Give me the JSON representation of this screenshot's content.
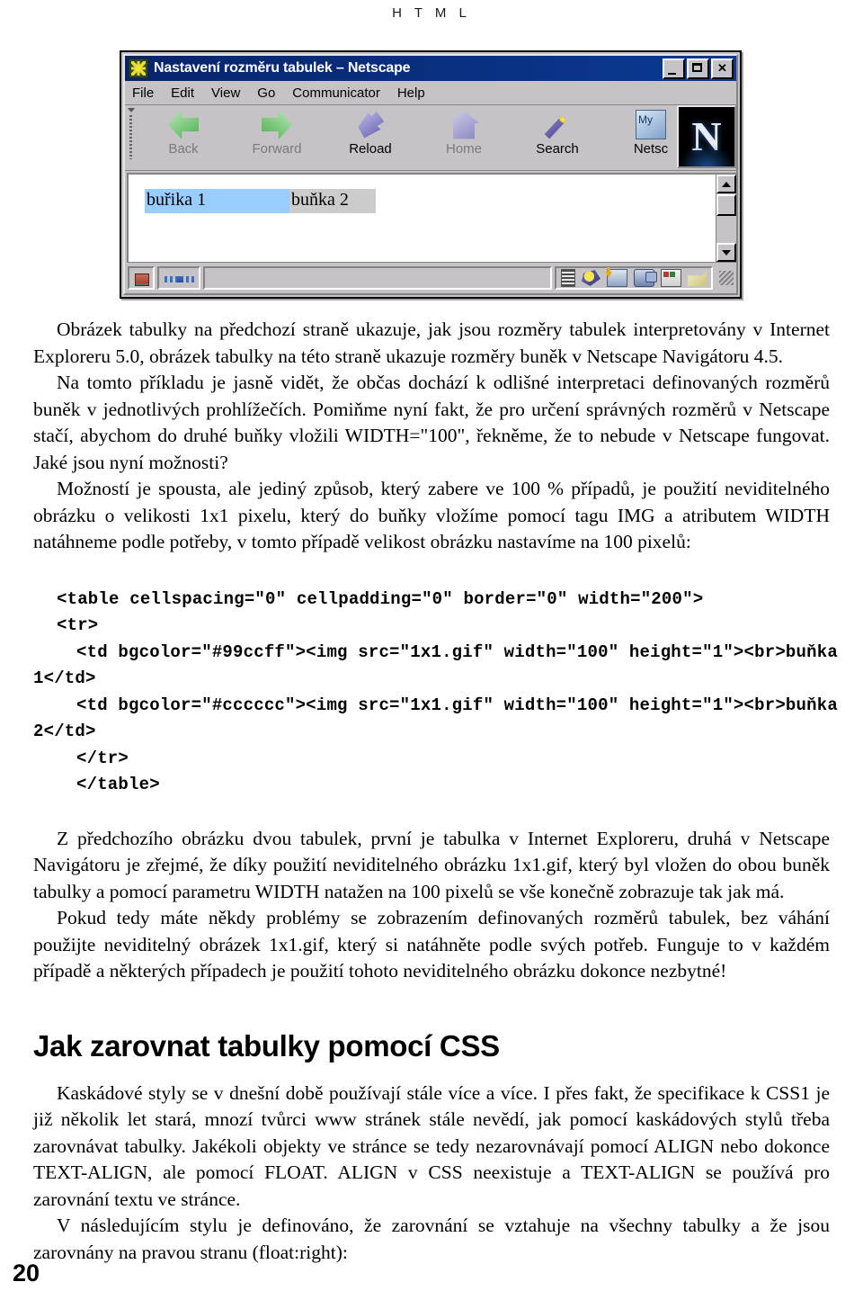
{
  "page": {
    "running_head": "H T M L",
    "folio": "20"
  },
  "figure": {
    "window": {
      "title": "Nastavení rozměru tabulek – Netscape",
      "icon": "netscape-page-icon",
      "buttons": {
        "minimize": "minimize-button",
        "maximize": "maximize-button",
        "close": "close-button"
      },
      "menu": [
        "File",
        "Edit",
        "View",
        "Go",
        "Communicator",
        "Help"
      ],
      "toolbar": [
        {
          "label": "Back",
          "icon": "back-arrow-icon",
          "enabled": false
        },
        {
          "label": "Forward",
          "icon": "forward-arrow-icon",
          "enabled": false
        },
        {
          "label": "Reload",
          "icon": "reload-icon",
          "enabled": true
        },
        {
          "label": "Home",
          "icon": "home-icon",
          "enabled": false
        },
        {
          "label": "Search",
          "icon": "search-icon",
          "enabled": true
        },
        {
          "label": "Netsc",
          "icon": "my-netscape-icon",
          "enabled": true
        }
      ],
      "logo_glyph": "N",
      "rendered_table": {
        "cell1": {
          "text": "buřika 1",
          "bgcolor": "#99ccff"
        },
        "cell2": {
          "text": "buňka 2",
          "bgcolor": "#cccccc"
        }
      },
      "statusbar": {
        "status_text": "",
        "lock_icon": "security-lock-icon",
        "connection_icon": "connection-icon",
        "icons": [
          "component-bar-icon",
          "navigator-icon",
          "mailbox-icon",
          "discussions-icon",
          "address-book-icon",
          "composer-icon"
        ],
        "resize_grip": "resize-grip-icon"
      }
    }
  },
  "body": {
    "paragraphs": [
      "Obrázek tabulky na předchozí straně ukazuje, jak jsou rozměry tabulek interpretovány v Internet Exploreru 5.0, obrázek tabulky na této straně ukazuje rozměry buněk v Netscape Navigátoru 4.5.",
      "Na tomto příkladu je jasně vidět, že občas dochází k odlišné interpretaci definovaných rozměrů buněk v jednotlivých prohlížečích. Pomiňme nyní fakt, že pro určení správných rozměrů v Netscape stačí, abychom do druhé buňky vložili WIDTH=\"100\", řekněme, že to nebude v Netscape fungovat. Jaké jsou nyní možnosti?",
      "Možností je spousta, ale jediný způsob, který zabere ve 100 % případů, je použití neviditelného obrázku o velikosti 1x1 pixelu, který do buňky vložíme pomocí tagu IMG a atributem WIDTH natáhneme podle potřeby, v tomto případě velikost obrázku nastavíme na 100 pixelů:"
    ],
    "code_lines": [
      "<table cellspacing=\"0\" cellpadding=\"0\" border=\"0\" width=\"200\">",
      "<tr>",
      "<td bgcolor=\"#99ccff\"><img src=\"1x1.gif\" width=\"100\" height=\"1\"><br>buňka",
      "1</td>",
      "<td bgcolor=\"#cccccc\"><img src=\"1x1.gif\" width=\"100\" height=\"1\"><br>buňka",
      "2</td>",
      "</tr>",
      "</table>"
    ],
    "paragraphs_after": [
      "Z předchozího obrázku dvou tabulek, první je tabulka v Internet Exploreru, druhá v Netscape Navigátoru je zřejmé, že díky použití neviditelného obrázku 1x1.gif, který byl vložen do obou buněk tabulky a pomocí parametru WIDTH natažen na 100 pixelů se vše konečně zobrazuje tak jak má.",
      "Pokud tedy máte někdy problémy se zobrazením definovaných rozměrů tabulek, bez váhání použijte neviditelný obrázek 1x1.gif, který si natáhněte podle svých potřeb. Funguje to v každém případě a některých případech je použití tohoto neviditelného obrázku dokonce nezbytné!"
    ],
    "section_heading": "Jak zarovnat tabulky pomocí CSS",
    "paragraphs_section": [
      "Kaskádové styly se v dnešní době používají stále více a více. I přes fakt, že specifikace k CSS1 je již několik let stará, mnozí tvůrci www stránek stále nevědí, jak pomocí kaskádových stylů třeba zarovnávat tabulky. Jakékoli objekty ve stránce se tedy nezarovnávají pomocí ALIGN nebo dokonce TEXT-ALIGN, ale pomocí FLOAT. ALIGN v CSS neexistuje a TEXT-ALIGN se používá pro zarovnání textu ve stránce.",
      "V následujícím stylu je definováno, že zarovnání se vztahuje na všechny tabulky a že jsou zarovnány na pravou stranu (float:right):"
    ]
  }
}
